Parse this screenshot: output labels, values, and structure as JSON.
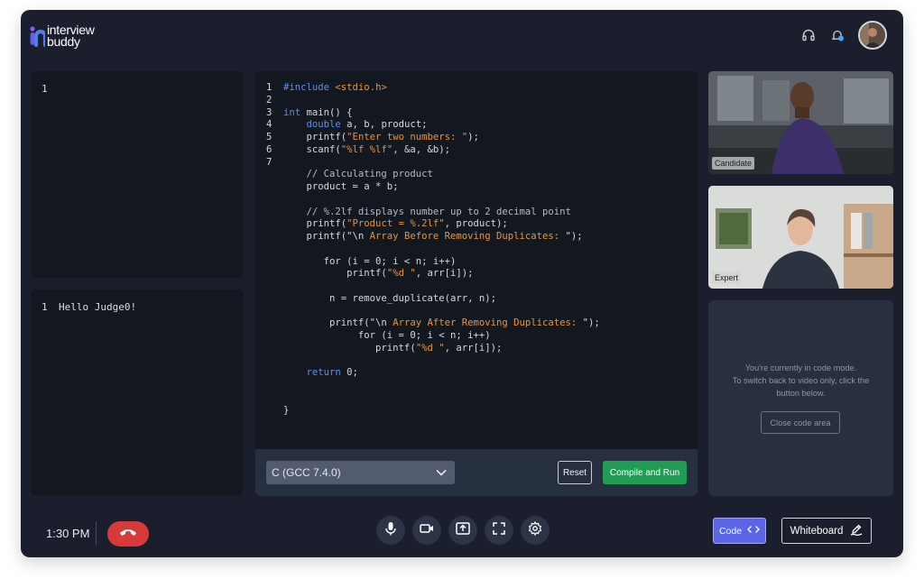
{
  "brand": {
    "line1": "interview",
    "line2": "buddy"
  },
  "input_panel": {
    "lines": [
      {
        "num": "1",
        "text": ""
      }
    ]
  },
  "output_panel": {
    "lines": [
      {
        "num": "1",
        "text": "Hello Judge0!"
      }
    ]
  },
  "editor": {
    "line_numbers": "1\n2\n3\n4\n5\n6\n7",
    "language": "C (GCC 7.4.0)",
    "reset_label": "Reset",
    "run_label": "Compile and Run"
  },
  "videos": {
    "candidate_label": "Candidate",
    "expert_label": "Expert"
  },
  "code_mode_info": {
    "line1": "You're currently in code mode.",
    "line2": "To switch back to video only, click the",
    "line3": "button below.",
    "close_label": "Close code area"
  },
  "footer": {
    "time": "1:30 PM",
    "code_label": "Code",
    "whiteboard_label": "Whiteboard"
  },
  "icons": [
    "logo-icon",
    "headset-icon",
    "notification-bell-icon",
    "chevron-down-icon",
    "end-call-icon",
    "microphone-icon",
    "camera-icon",
    "share-screen-icon",
    "fullscreen-icon",
    "settings-icon",
    "code-brackets-icon",
    "whiteboard-edit-icon"
  ],
  "colors": {
    "accent": "#5a66e6",
    "run": "#1f9d55",
    "end_call": "#d63a3a",
    "background": "#1b1f2d"
  }
}
